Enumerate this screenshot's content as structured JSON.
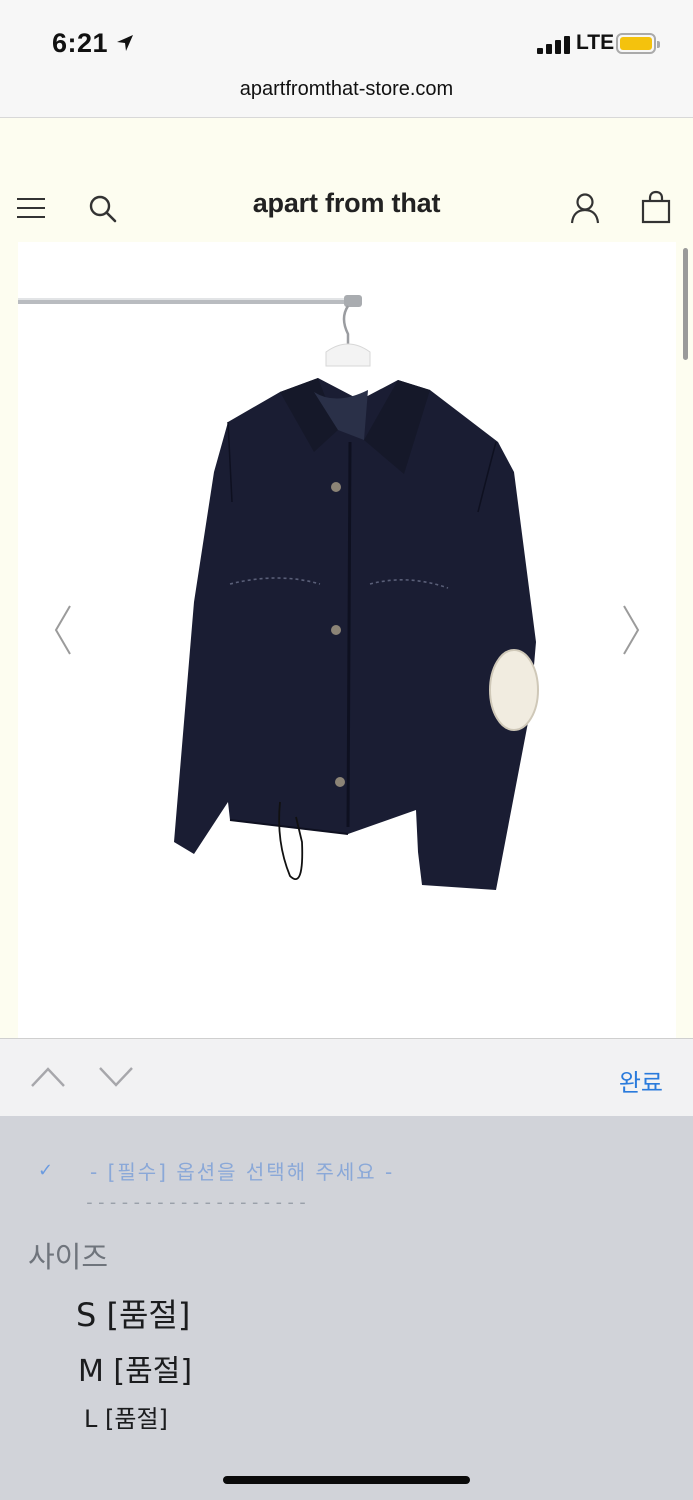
{
  "status_bar": {
    "time": "6:21",
    "network": "LTE",
    "battery_color": "#f4c20d"
  },
  "browser": {
    "url": "apartfromthat-store.com"
  },
  "site": {
    "brand": "apart from that",
    "background": "#fdfdf0",
    "icons": [
      "menu-icon",
      "search-icon",
      "account-icon",
      "cart-icon"
    ],
    "gallery": {
      "prev_icon": "chevron-left-icon",
      "next_icon": "chevron-right-icon"
    }
  },
  "keyboard_bar": {
    "done_label": "완료",
    "done_color": "#2a7bdc"
  },
  "picker": {
    "selected_option": "- [필수] 옵션을 선택해 주세요 -",
    "divider": "-------------------",
    "group_label": "사이즈",
    "options": [
      "S [품절]",
      "M [품절]",
      "L [품절]"
    ]
  }
}
